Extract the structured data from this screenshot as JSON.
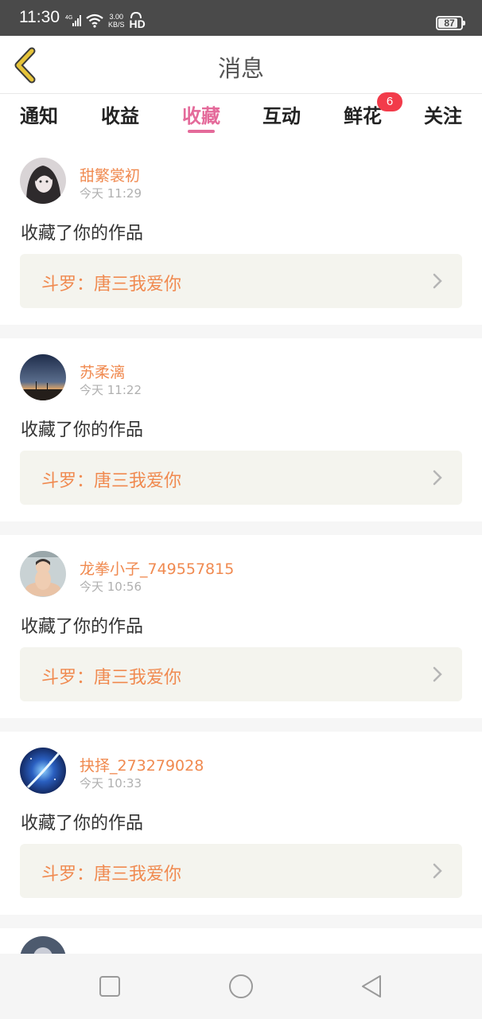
{
  "status_bar": {
    "time": "11:30",
    "signal_label": "4G",
    "net_speed_value": "3.00",
    "net_speed_unit": "KB/S",
    "hd_label": "HD",
    "battery": "87",
    "battery_level_percent": 87
  },
  "header": {
    "title": "消息",
    "back_icon": "chevron-left-icon"
  },
  "tabs": [
    {
      "label": "通知",
      "active": false
    },
    {
      "label": "收益",
      "active": false
    },
    {
      "label": "收藏",
      "active": true
    },
    {
      "label": "互动",
      "active": false
    },
    {
      "label": "鲜花",
      "active": false,
      "badge": "6"
    },
    {
      "label": "关注",
      "active": false
    }
  ],
  "colors": {
    "accent_pink": "#e46a9a",
    "name_orange": "#f08a50",
    "badge_red": "#f23b4a",
    "back_arrow_yellow": "#e6c43a"
  },
  "messages": [
    {
      "user": "甜繁裳初",
      "time": "今天 11:29",
      "action": "收藏了你的作品",
      "work_title": "斗罗：唐三我爱你"
    },
    {
      "user": "苏柔漓",
      "time": "今天 11:22",
      "action": "收藏了你的作品",
      "work_title": "斗罗：唐三我爱你"
    },
    {
      "user": "龙拳小子_749557815",
      "time": "今天 10:56",
      "action": "收藏了你的作品",
      "work_title": "斗罗：唐三我爱你"
    },
    {
      "user": "抉择_273279028",
      "time": "今天 10:33",
      "action": "收藏了你的作品",
      "work_title": "斗罗：唐三我爱你"
    }
  ],
  "system_nav": {
    "recents_icon": "square-icon",
    "home_icon": "circle-icon",
    "back_icon": "triangle-back-icon"
  }
}
